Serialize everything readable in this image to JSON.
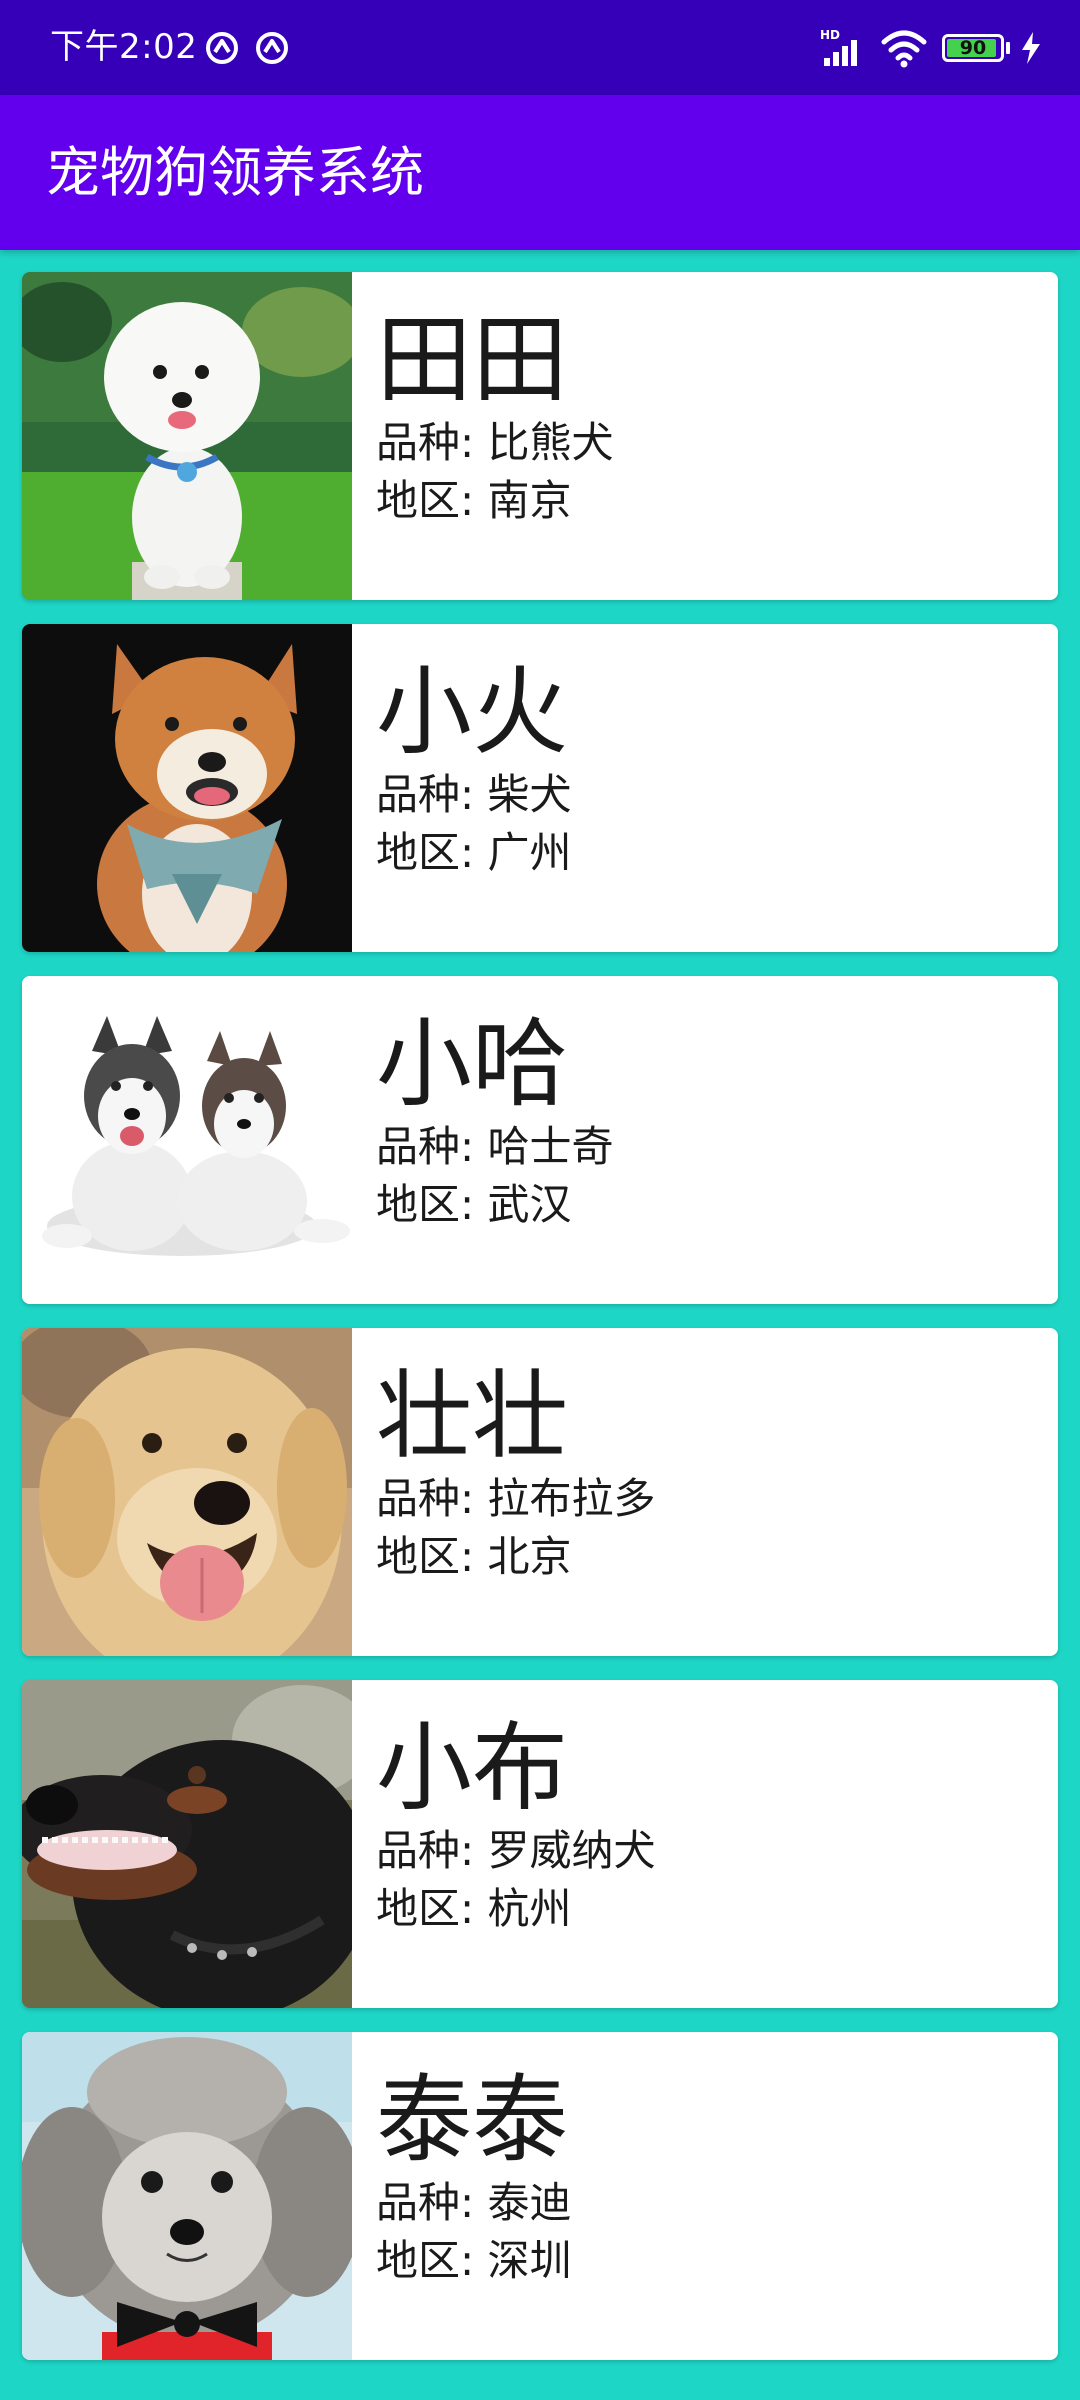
{
  "status_bar": {
    "time": "下午2:02",
    "battery_level": "90",
    "network": "HD",
    "icons": [
      "notification-icon",
      "notification-icon",
      "signal-icon",
      "wifi-icon",
      "battery-icon",
      "charging-icon"
    ]
  },
  "app_bar": {
    "title": "宠物狗领养系统"
  },
  "labels": {
    "breed_prefix": "品种: ",
    "region_prefix": "地区: "
  },
  "pets": [
    {
      "name": "田田",
      "breed": "品种: 比熊犬",
      "region": "地区: 南京"
    },
    {
      "name": "小火",
      "breed": "品种: 柴犬",
      "region": "地区: 广州"
    },
    {
      "name": "小哈",
      "breed": "品种: 哈士奇",
      "region": "地区: 武汉"
    },
    {
      "name": "壮壮",
      "breed": "品种: 拉布拉多",
      "region": "地区: 北京"
    },
    {
      "name": "小布",
      "breed": "品种: 罗威纳犬",
      "region": "地区: 杭州"
    },
    {
      "name": "泰泰",
      "breed": "品种: 泰迪",
      "region": "地区: 深圳"
    }
  ],
  "colors": {
    "status_bar": "#3600B8",
    "app_bar": "#6200EE",
    "list_background": "#1ED6C6",
    "card_background": "#FFFFFF"
  }
}
